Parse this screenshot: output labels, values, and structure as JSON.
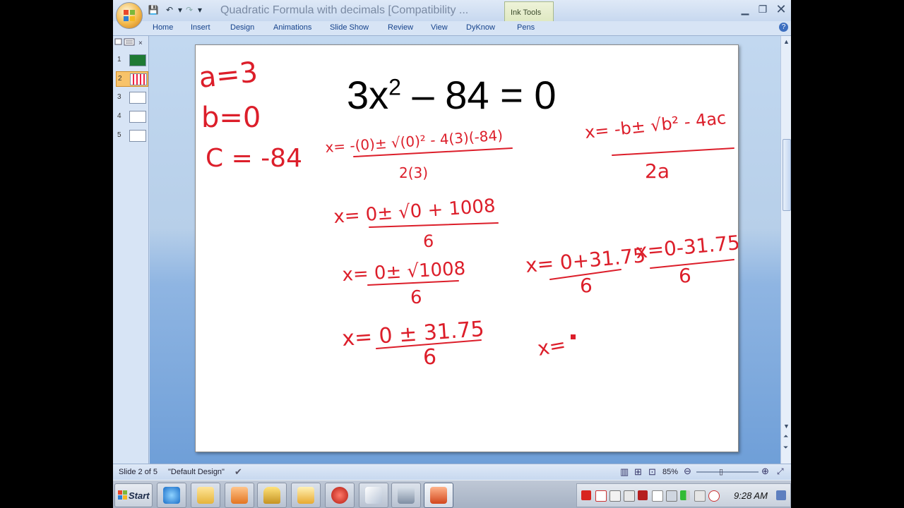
{
  "window": {
    "title": "Quadratic Formula with decimals [Compatibility ...",
    "context_tab": "Ink Tools"
  },
  "ribbon": {
    "tabs": [
      "Home",
      "Insert",
      "Design",
      "Animations",
      "Slide Show",
      "Review",
      "View",
      "DyKnow",
      "Pens"
    ]
  },
  "thumbnails": [
    "1",
    "2",
    "3",
    "4",
    "5"
  ],
  "slide": {
    "equation_base": "3x",
    "equation_exp": "2",
    "equation_rest": " – 84 = 0"
  },
  "ink": {
    "a": "a=3",
    "b": "b=0",
    "c": "C = -84",
    "step1_num": "x= -(0)± √(0)² - 4(3)(-84)",
    "step1_den": "2(3)",
    "formula_num": "x= -b± √b² - 4ac",
    "formula_den": "2a",
    "step2_num": "x= 0± √0 + 1008",
    "step2_den": "6",
    "step3_num": "x= 0± √1008",
    "step3_den": "6",
    "step4_num": "x= 0 ± 31.75",
    "step4_den": "6",
    "plus_num": "x= 0+31.75",
    "plus_den": "6",
    "minus_num": "x=0-31.75",
    "minus_den": "6",
    "final": "x="
  },
  "status": {
    "slide_info": "Slide 2 of 5",
    "theme": "\"Default Design\"",
    "zoom": "85%"
  },
  "taskbar": {
    "start": "Start",
    "clock": "9:28 AM"
  },
  "colors": {
    "ink": "#dc1e2a",
    "ribbon": "#d7e4f5"
  }
}
